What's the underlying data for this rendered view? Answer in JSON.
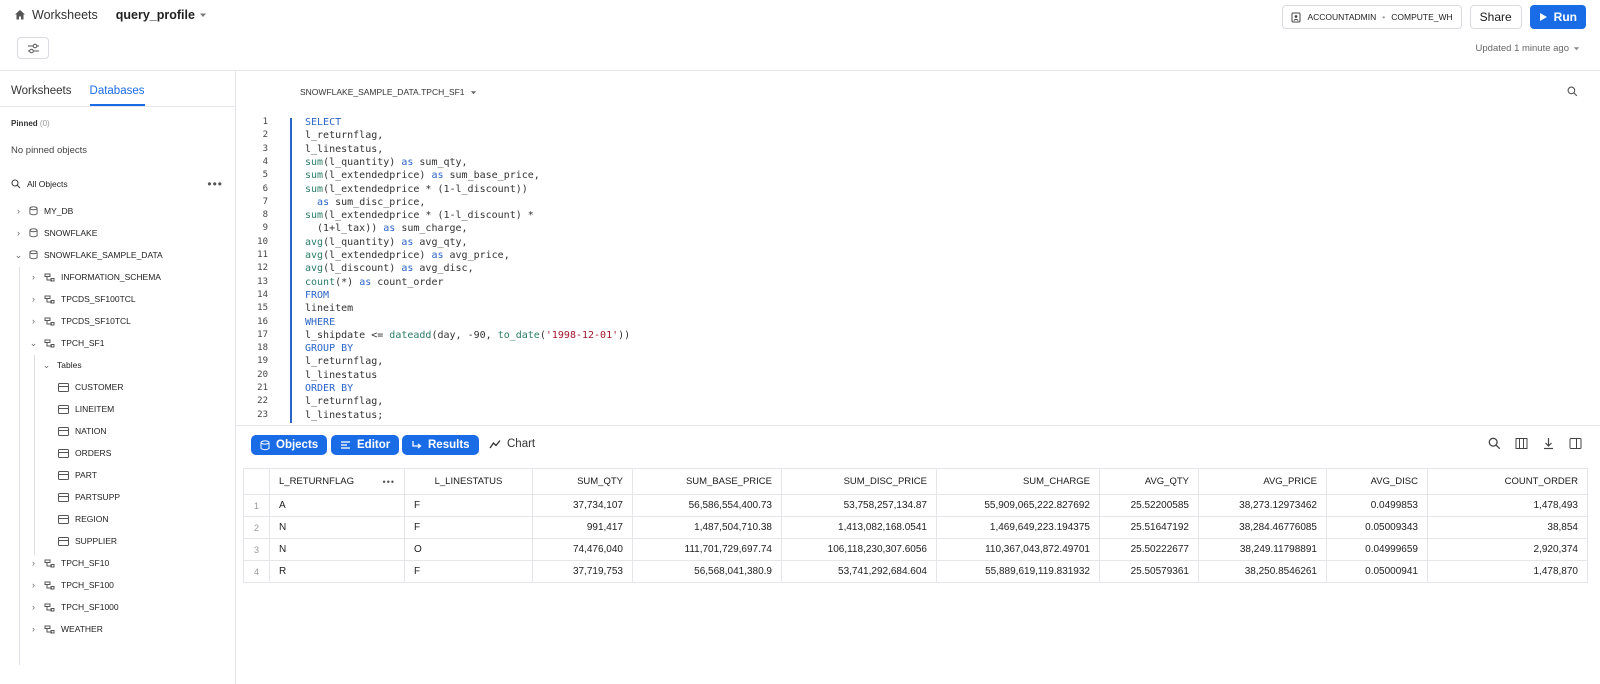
{
  "topbar": {
    "worksheets_label": "Worksheets",
    "worksheet_title": "query_profile",
    "role": "ACCOUNTADMIN",
    "warehouse": "COMPUTE_WH",
    "share_label": "Share",
    "run_label": "Run",
    "updated": "Updated 1 minute ago"
  },
  "sidebar": {
    "tabs": [
      "Worksheets",
      "Databases"
    ],
    "active_tab": "Databases",
    "pinned_label": "Pinned",
    "pinned_count": "(0)",
    "pinned_empty": "No pinned objects",
    "all_objects": "All Objects",
    "tree": [
      {
        "label": "MY_DB",
        "level": 0,
        "kind": "db",
        "expanded": false
      },
      {
        "label": "SNOWFLAKE",
        "level": 0,
        "kind": "db",
        "expanded": false
      },
      {
        "label": "SNOWFLAKE_SAMPLE_DATA",
        "level": 0,
        "kind": "db",
        "expanded": true
      },
      {
        "label": "INFORMATION_SCHEMA",
        "level": 1,
        "kind": "schema",
        "expanded": false
      },
      {
        "label": "TPCDS_SF100TCL",
        "level": 1,
        "kind": "schema",
        "expanded": false
      },
      {
        "label": "TPCDS_SF10TCL",
        "level": 1,
        "kind": "schema",
        "expanded": false
      },
      {
        "label": "TPCH_SF1",
        "level": 1,
        "kind": "schema",
        "expanded": true
      },
      {
        "label": "Tables",
        "level": 2,
        "kind": "folder",
        "expanded": true
      },
      {
        "label": "CUSTOMER",
        "level": 3,
        "kind": "table"
      },
      {
        "label": "LINEITEM",
        "level": 3,
        "kind": "table"
      },
      {
        "label": "NATION",
        "level": 3,
        "kind": "table"
      },
      {
        "label": "ORDERS",
        "level": 3,
        "kind": "table"
      },
      {
        "label": "PART",
        "level": 3,
        "kind": "table"
      },
      {
        "label": "PARTSUPP",
        "level": 3,
        "kind": "table"
      },
      {
        "label": "REGION",
        "level": 3,
        "kind": "table"
      },
      {
        "label": "SUPPLIER",
        "level": 3,
        "kind": "table"
      },
      {
        "label": "TPCH_SF10",
        "level": 1,
        "kind": "schema",
        "expanded": false
      },
      {
        "label": "TPCH_SF100",
        "level": 1,
        "kind": "schema",
        "expanded": false
      },
      {
        "label": "TPCH_SF1000",
        "level": 1,
        "kind": "schema",
        "expanded": false
      },
      {
        "label": "WEATHER",
        "level": 1,
        "kind": "schema",
        "expanded": false
      }
    ]
  },
  "editor": {
    "context": "SNOWFLAKE_SAMPLE_DATA.TPCH_SF1",
    "lines": [
      [
        {
          "t": "SELECT",
          "c": "kw"
        }
      ],
      [
        {
          "t": "l_returnflag,",
          "c": ""
        }
      ],
      [
        {
          "t": "l_linestatus,",
          "c": ""
        }
      ],
      [
        {
          "t": "sum",
          "c": "fn"
        },
        {
          "t": "(l_quantity) ",
          "c": ""
        },
        {
          "t": "as",
          "c": "kw"
        },
        {
          "t": " sum_qty,",
          "c": ""
        }
      ],
      [
        {
          "t": "sum",
          "c": "fn"
        },
        {
          "t": "(l_extendedprice) ",
          "c": ""
        },
        {
          "t": "as",
          "c": "kw"
        },
        {
          "t": " sum_base_price,",
          "c": ""
        }
      ],
      [
        {
          "t": "sum",
          "c": "fn"
        },
        {
          "t": "(l_extendedprice * (1-l_discount))",
          "c": ""
        }
      ],
      [
        {
          "t": "  ",
          "c": ""
        },
        {
          "t": "as",
          "c": "kw"
        },
        {
          "t": " sum_disc_price,",
          "c": ""
        }
      ],
      [
        {
          "t": "sum",
          "c": "fn"
        },
        {
          "t": "(l_extendedprice * (1-l_discount) *",
          "c": ""
        }
      ],
      [
        {
          "t": "  (1+l_tax)) ",
          "c": ""
        },
        {
          "t": "as",
          "c": "kw"
        },
        {
          "t": " sum_charge,",
          "c": ""
        }
      ],
      [
        {
          "t": "avg",
          "c": "fn"
        },
        {
          "t": "(l_quantity) ",
          "c": ""
        },
        {
          "t": "as",
          "c": "kw"
        },
        {
          "t": " avg_qty,",
          "c": ""
        }
      ],
      [
        {
          "t": "avg",
          "c": "fn"
        },
        {
          "t": "(l_extendedprice) ",
          "c": ""
        },
        {
          "t": "as",
          "c": "kw"
        },
        {
          "t": " avg_price,",
          "c": ""
        }
      ],
      [
        {
          "t": "avg",
          "c": "fn"
        },
        {
          "t": "(l_discount) ",
          "c": ""
        },
        {
          "t": "as",
          "c": "kw"
        },
        {
          "t": " avg_disc,",
          "c": ""
        }
      ],
      [
        {
          "t": "count",
          "c": "fn"
        },
        {
          "t": "(*) ",
          "c": ""
        },
        {
          "t": "as",
          "c": "kw"
        },
        {
          "t": " count_order",
          "c": ""
        }
      ],
      [
        {
          "t": "FROM",
          "c": "kw"
        }
      ],
      [
        {
          "t": "lineitem",
          "c": ""
        }
      ],
      [
        {
          "t": "WHERE",
          "c": "kw"
        }
      ],
      [
        {
          "t": "l_shipdate <= ",
          "c": ""
        },
        {
          "t": "dateadd",
          "c": "fn"
        },
        {
          "t": "(day, -90, ",
          "c": ""
        },
        {
          "t": "to_date",
          "c": "fn"
        },
        {
          "t": "(",
          "c": ""
        },
        {
          "t": "'1998-12-01'",
          "c": "str"
        },
        {
          "t": "))",
          "c": ""
        }
      ],
      [
        {
          "t": "GROUP BY",
          "c": "kw"
        }
      ],
      [
        {
          "t": "l_returnflag,",
          "c": ""
        }
      ],
      [
        {
          "t": "l_linestatus",
          "c": ""
        }
      ],
      [
        {
          "t": "ORDER BY",
          "c": "kw"
        }
      ],
      [
        {
          "t": "l_returnflag,",
          "c": ""
        }
      ],
      [
        {
          "t": "l_linestatus;",
          "c": ""
        }
      ]
    ]
  },
  "results_toolbar": {
    "objects_label": "Objects",
    "editor_label": "Editor",
    "results_label": "Results",
    "chart_label": "Chart"
  },
  "results": {
    "columns": [
      "L_RETURNFLAG",
      "L_LINESTATUS",
      "SUM_QTY",
      "SUM_BASE_PRICE",
      "SUM_DISC_PRICE",
      "SUM_CHARGE",
      "AVG_QTY",
      "AVG_PRICE",
      "AVG_DISC",
      "COUNT_ORDER"
    ],
    "rows": [
      [
        "1",
        "A",
        "F",
        "37,734,107",
        "56,586,554,400.73",
        "53,758,257,134.87",
        "55,909,065,222.827692",
        "25.52200585",
        "38,273.12973462",
        "0.0499853",
        "1,478,493"
      ],
      [
        "2",
        "N",
        "F",
        "991,417",
        "1,487,504,710.38",
        "1,413,082,168.0541",
        "1,469,649,223.194375",
        "25.51647192",
        "38,284.46776085",
        "0.05009343",
        "38,854"
      ],
      [
        "3",
        "N",
        "O",
        "74,476,040",
        "111,701,729,697.74",
        "106,118,230,307.6056",
        "110,367,043,872.49701",
        "25.50222677",
        "38,249.11798891",
        "0.04999659",
        "2,920,374"
      ],
      [
        "4",
        "R",
        "F",
        "37,719,753",
        "56,568,041,380.9",
        "53,741,292,684.604",
        "55,889,619,119.831932",
        "25.50579361",
        "38,250.8546261",
        "0.05000941",
        "1,478,870"
      ]
    ]
  },
  "colors": {
    "accent": "#1a6ce6",
    "keyword": "#2a64c8",
    "function": "#2a7d66",
    "string": "#a4162c"
  }
}
